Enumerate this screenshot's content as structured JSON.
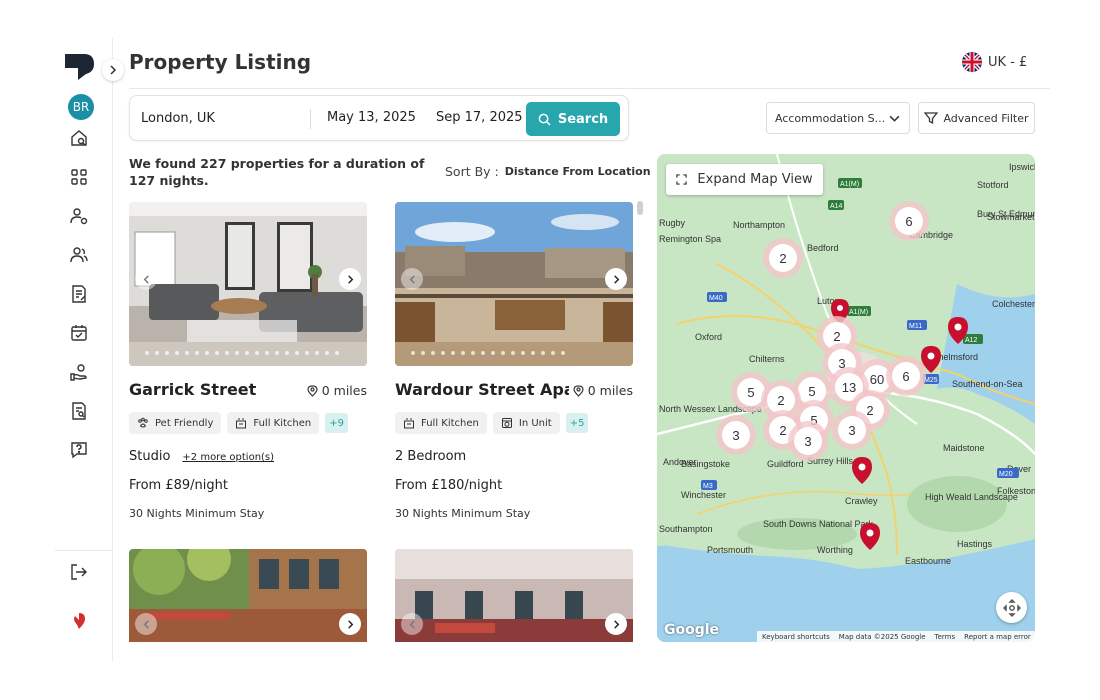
{
  "sidebar": {
    "avatar_initials": "BR",
    "nav_icons": [
      "home-search-icon",
      "grid-icon",
      "user-settings-icon",
      "users-icon",
      "document-edit-icon",
      "calendar-check-icon",
      "hand-coin-icon",
      "document-search-icon",
      "help-chat-icon"
    ],
    "bottom_icons": [
      "logout-icon",
      "brand-pin-icon"
    ]
  },
  "header": {
    "title": "Property Listing",
    "locale": "UK - £"
  },
  "search": {
    "location": "London, UK",
    "check_in": "May 13, 2025",
    "check_out": "Sep 17, 2025",
    "button_label": "Search"
  },
  "filters": {
    "accommodation_label": "Accommodation S...",
    "advanced_label": "Advanced Filter"
  },
  "results": {
    "summary": "We found 227 properties for a duration of 127 nights.",
    "sort_label": "Sort By :",
    "sort_value": "Distance From Location"
  },
  "listings": [
    {
      "name": "Garrick Street",
      "distance": "0 miles",
      "tags": [
        "Pet Friendly",
        "Full Kitchen"
      ],
      "tag_icons": [
        "paw-icon",
        "kitchen-icon"
      ],
      "more_tags": "+9",
      "type": "Studio",
      "more_options": "+2 more option(s)",
      "price": "From £89/night",
      "min_stay": "30 Nights Minimum Stay"
    },
    {
      "name": "Wardour Street Apar...",
      "distance": "0 miles",
      "tags": [
        "Full Kitchen",
        "In Unit"
      ],
      "tag_icons": [
        "kitchen-icon",
        "washer-icon"
      ],
      "more_tags": "+5",
      "type": "2 Bedroom",
      "more_options": "",
      "price": "From £180/night",
      "min_stay": "30 Nights Minimum Stay"
    },
    {
      "name": "",
      "distance": ""
    },
    {
      "name": "",
      "distance": ""
    }
  ],
  "map": {
    "expand_label": "Expand Map View",
    "place_labels": [
      "Northampton",
      "Bedford",
      "Rugby",
      "Remington Spa",
      "Oxford",
      "Cambridge",
      "Colchester",
      "Chelmsford",
      "Southend-on-Sea",
      "Maidstone",
      "Basingstoke",
      "Guildford",
      "Crawley",
      "Winchester",
      "Southampton",
      "Portsmouth",
      "Worthing",
      "Eastbourne",
      "Andover",
      "Hastings",
      "Dover",
      "Folkestone",
      "Ipswich",
      "Stowmarket",
      "Bury St Edmunds",
      "Stotford",
      "Luton",
      "High Weald Landscape",
      "South Downs National Park",
      "North Wessex Landscape",
      "Chilterns",
      "Surrey Hills"
    ],
    "road_labels": [
      "A1(M)",
      "A14",
      "M40",
      "M11",
      "A12",
      "M20",
      "M3",
      "M25",
      "A1(M)"
    ],
    "clusters": [
      "6",
      "2",
      "2",
      "3",
      "60",
      "6",
      "5",
      "5",
      "13",
      "2",
      "2",
      "5",
      "2",
      "3",
      "3",
      "3"
    ],
    "footer": [
      "Keyboard shortcuts",
      "Map data ©2025 Google",
      "Terms",
      "Report a map error"
    ],
    "brand": "Google"
  },
  "colors": {
    "accent": "#27a6ad",
    "avatar": "#1a8fa5",
    "marker": "#c8102e",
    "cluster": "#f4c6cb",
    "map_land": "#c8e6c4",
    "map_sea": "#9fd0ec"
  }
}
